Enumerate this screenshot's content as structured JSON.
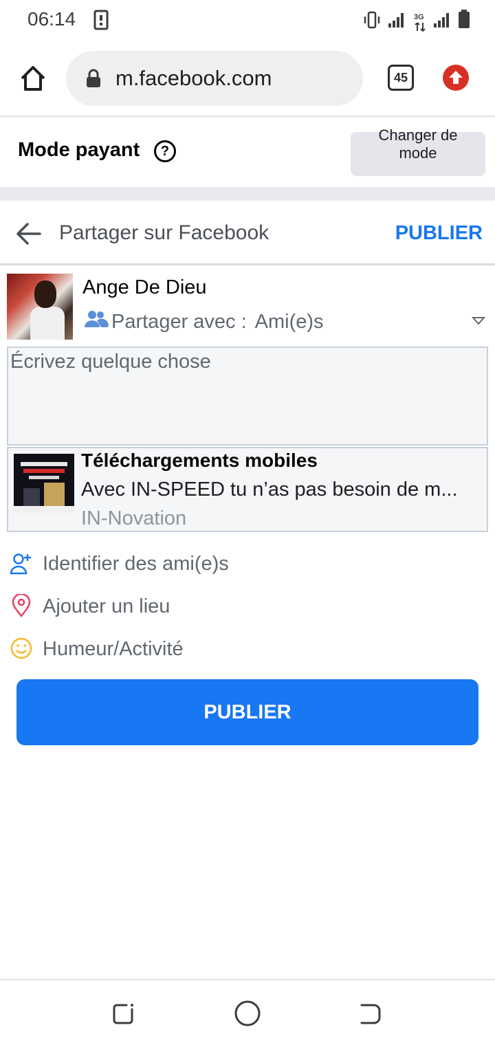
{
  "status_bar": {
    "time": "06:14",
    "network_label": "3G"
  },
  "browser": {
    "url": "m.facebook.com",
    "tab_count": "45"
  },
  "mode": {
    "title": "Mode payant",
    "help_symbol": "?",
    "change_line1": "Changer de",
    "change_line2": "mode"
  },
  "share_header": {
    "title": "Partager sur Facebook",
    "publish_label": "PUBLIER"
  },
  "user": {
    "name": "Ange De Dieu",
    "privacy_prefix": "Partager avec :",
    "privacy_value": "Ami(e)s"
  },
  "composer": {
    "placeholder": "Écrivez quelque chose"
  },
  "link_card": {
    "title": "Téléchargements mobiles",
    "description": "Avec IN-SPEED tu n’as pas besoin de m...",
    "source": "IN-Novation"
  },
  "actions": [
    {
      "label": "Identifier des ami(e)s",
      "icon": "add-person-icon",
      "color": "#1877f2"
    },
    {
      "label": "Ajouter un lieu",
      "icon": "location-pin-icon",
      "color": "#e4405f"
    },
    {
      "label": "Humeur/Activité",
      "icon": "smiley-icon",
      "color": "#f7b928"
    }
  ],
  "publish_button_label": "PUBLIER",
  "colors": {
    "accent": "#1877f2",
    "update_badge": "#d93025"
  }
}
